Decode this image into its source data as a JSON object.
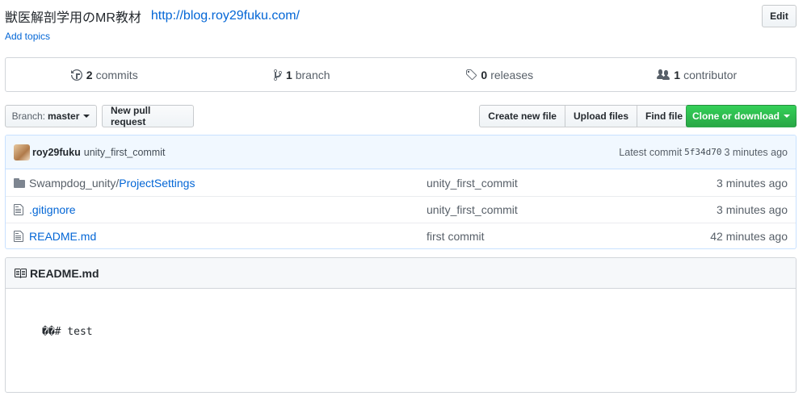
{
  "repo": {
    "description": "獣医解剖学用のMR教材",
    "website": "http://blog.roy29fuku.com/",
    "add_topics": "Add topics",
    "edit_label": "Edit"
  },
  "summary": {
    "commits": {
      "count": "2",
      "label": "commits",
      "icon": "history-icon"
    },
    "branches": {
      "count": "1",
      "label": "branch",
      "icon": "git-branch-icon"
    },
    "releases": {
      "count": "0",
      "label": "releases",
      "icon": "tag-icon"
    },
    "contributors": {
      "count": "1",
      "label": "contributor",
      "icon": "people-icon"
    }
  },
  "toolbar": {
    "branch_prefix": "Branch:",
    "branch_name": "master",
    "new_pull_request": "New pull request",
    "create_new_file": "Create new file",
    "upload_files": "Upload files",
    "find_file": "Find file",
    "clone_or_download": "Clone or download"
  },
  "latest_commit": {
    "author": "roy29fuku",
    "message": "unity_first_commit",
    "prefix": "Latest commit",
    "sha": "5f34d70",
    "age": "3 minutes ago"
  },
  "files": [
    {
      "type": "directory",
      "icon": "folder-icon",
      "name_prefix": "Swampdog_unity/",
      "name": "ProjectSettings",
      "message": "unity_first_commit",
      "age": "3 minutes ago"
    },
    {
      "type": "file",
      "icon": "file-icon",
      "name_prefix": "",
      "name": ".gitignore",
      "message": "unity_first_commit",
      "age": "3 minutes ago"
    },
    {
      "type": "file",
      "icon": "file-icon",
      "name_prefix": "",
      "name": "README.md",
      "message": "first commit",
      "age": "42 minutes ago"
    }
  ],
  "readme": {
    "title": "README.md",
    "content": "��# test"
  },
  "colors": {
    "link": "#0366d6",
    "clone_button": "#28a745",
    "commit_bar": "#f1f8ff"
  }
}
